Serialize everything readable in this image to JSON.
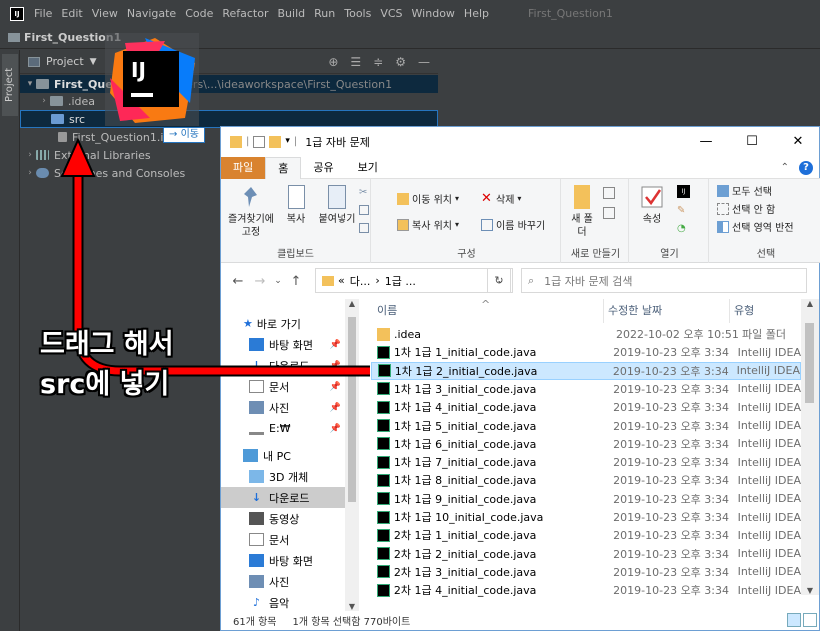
{
  "ide": {
    "menu": [
      "File",
      "Edit",
      "View",
      "Navigate",
      "Code",
      "Refactor",
      "Build",
      "Run",
      "Tools",
      "VCS",
      "Window",
      "Help"
    ],
    "window_title": "First_Question1",
    "breadcrumb": "First_Question1",
    "side_tab": "Project",
    "project_panel_label": "Project",
    "tree": {
      "root_label": "First_Question1",
      "root_path": "C:\\Users\\...\\ideaworkspace\\First_Question1",
      "idea_label": ".idea",
      "src_label": "src",
      "iml_label": "First_Question1.iml",
      "ext_libs_label": "External Libraries",
      "scratches_label": "Scratches and Consoles"
    },
    "move_tooltip": "→ 이동"
  },
  "explorer": {
    "title": "1급 자바 문제",
    "ribbon_tabs": [
      "파일",
      "홈",
      "공유",
      "보기"
    ],
    "clipboard": {
      "pin": "즐겨찾기에 고정",
      "copy": "복사",
      "paste": "붙여넣기",
      "group": "클립보드"
    },
    "organize": {
      "move_to": "이동 위치",
      "delete": "삭제",
      "copy_to": "복사 위치",
      "rename": "이름 바꾸기",
      "group": "구성"
    },
    "new": {
      "new_folder": "새 폴더",
      "group": "새로 만들기"
    },
    "open": {
      "properties": "속성",
      "group": "열기"
    },
    "select": {
      "all": "모두 선택",
      "none": "선택 안 함",
      "invert": "선택 영역 반전",
      "group": "선택"
    },
    "address": {
      "prefix": "«",
      "part1": "다...",
      "part2": "1급 ..."
    },
    "search_placeholder": "1급 자바 문제 검색",
    "nav": {
      "quick_access": "바로 가기",
      "desktop": "바탕 화면",
      "downloads": "다운로드",
      "documents": "문서",
      "pictures": "사진",
      "drive": "E:₩",
      "this_pc": "내 PC",
      "objects3d": "3D 개체",
      "downloads2": "다운로드",
      "videos": "동영상",
      "documents2": "문서",
      "desktop2": "바탕 화면",
      "pictures2": "사진",
      "music": "음악"
    },
    "columns": {
      "name": "이름",
      "modified": "수정한 날짜",
      "type": "유형"
    },
    "files": [
      {
        "name": ".idea",
        "date": "2022-10-02 오후 10:51",
        "type": "파일 폴더"
      },
      {
        "name": "1차 1급 1_initial_code.java",
        "date": "2019-10-23 오후 3:34",
        "type": "IntelliJ IDEA"
      },
      {
        "name": "1차 1급 2_initial_code.java",
        "date": "2019-10-23 오후 3:34",
        "type": "IntelliJ IDEA"
      },
      {
        "name": "1차 1급 3_initial_code.java",
        "date": "2019-10-23 오후 3:34",
        "type": "IntelliJ IDEA"
      },
      {
        "name": "1차 1급 4_initial_code.java",
        "date": "2019-10-23 오후 3:34",
        "type": "IntelliJ IDEA"
      },
      {
        "name": "1차 1급 5_initial_code.java",
        "date": "2019-10-23 오후 3:34",
        "type": "IntelliJ IDEA"
      },
      {
        "name": "1차 1급 6_initial_code.java",
        "date": "2019-10-23 오후 3:34",
        "type": "IntelliJ IDEA"
      },
      {
        "name": "1차 1급 7_initial_code.java",
        "date": "2019-10-23 오후 3:34",
        "type": "IntelliJ IDEA"
      },
      {
        "name": "1차 1급 8_initial_code.java",
        "date": "2019-10-23 오후 3:34",
        "type": "IntelliJ IDEA"
      },
      {
        "name": "1차 1급 9_initial_code.java",
        "date": "2019-10-23 오후 3:34",
        "type": "IntelliJ IDEA"
      },
      {
        "name": "1차 1급 10_initial_code.java",
        "date": "2019-10-23 오후 3:34",
        "type": "IntelliJ IDEA"
      },
      {
        "name": "2차 1급 1_initial_code.java",
        "date": "2019-10-23 오후 3:34",
        "type": "IntelliJ IDEA"
      },
      {
        "name": "2차 1급 2_initial_code.java",
        "date": "2019-10-23 오후 3:34",
        "type": "IntelliJ IDEA"
      },
      {
        "name": "2차 1급 3_initial_code.java",
        "date": "2019-10-23 오후 3:34",
        "type": "IntelliJ IDEA"
      },
      {
        "name": "2차 1급 4_initial_code.java",
        "date": "2019-10-23 오후 3:34",
        "type": "IntelliJ IDEA"
      }
    ],
    "status_count": "61개 항목",
    "status_selected": "1개 항목 선택함 770바이트"
  },
  "annotation": {
    "line1": "드래그 해서",
    "line2": "src에 넣기",
    "color": "#ff0000"
  }
}
